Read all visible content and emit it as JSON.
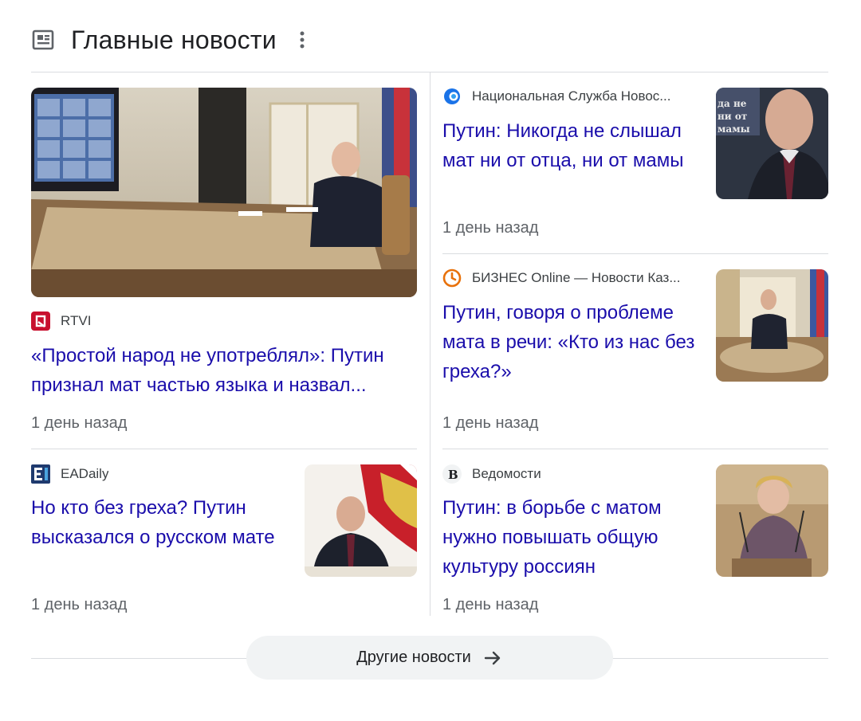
{
  "header": {
    "title": "Главные новости"
  },
  "articles": [
    {
      "source": "RTVI",
      "logo_letter": "R",
      "logo_color": "#c8102e",
      "headline": "«Простой народ не употреблял»: Путин признал мат частью языка и назвал...",
      "time": "1 день назад"
    },
    {
      "source": "Национальная Служба Новос...",
      "logo_letter": "C",
      "logo_color": "#1a73e8",
      "headline": "Путин: Никогда не слышал мат ни от отца, ни от мамы",
      "time": "1 день назад"
    },
    {
      "source": "БИЗНЕС Online — Новости Каз...",
      "logo_letter": "",
      "logo_color": "#e8710a",
      "headline": "Путин, говоря о проблеме мата в речи: «Кто из нас без греха?»",
      "time": "1 день назад"
    },
    {
      "source": "EADaily",
      "logo_letter": "E",
      "logo_color": "#1f3a6e",
      "headline": "Но кто без греха? Путин высказался о русском мате",
      "time": "1 день назад"
    },
    {
      "source": "Ведомости",
      "logo_letter": "В",
      "logo_color": "#202124",
      "headline": "Путин: в борьбе с матом нужно повышать общую культуру россиян",
      "time": "1 день назад"
    }
  ],
  "footer": {
    "more_label": "Другие новости"
  },
  "colors": {
    "link": "#1a0dab",
    "meta": "#5f6368",
    "divider": "#dadce0",
    "button_bg": "#f1f3f4"
  }
}
